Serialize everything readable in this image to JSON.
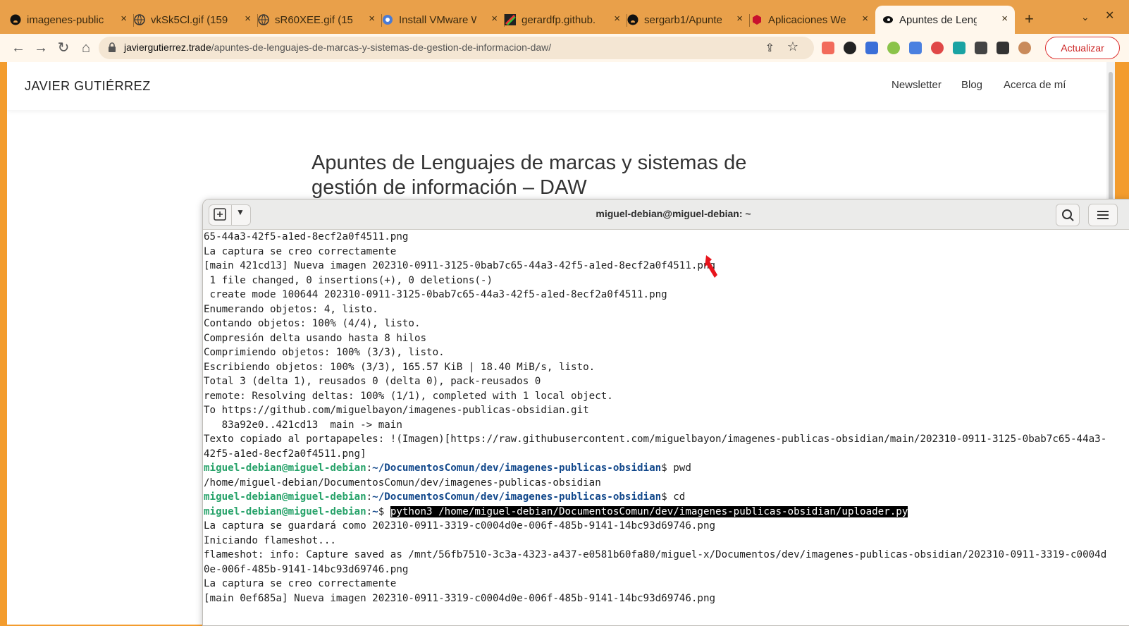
{
  "tabs": [
    {
      "title": "imagenes-public",
      "icon": "github-icon"
    },
    {
      "title": "vkSk5Cl.gif (1598",
      "icon": "globe-icon"
    },
    {
      "title": "sR60XEE.gif (159",
      "icon": "globe-icon"
    },
    {
      "title": "Install VMware W",
      "icon": "chrome-icon"
    },
    {
      "title": "gerardfp.github.",
      "icon": "gerardfp-icon"
    },
    {
      "title": "sergarb1/Apunte",
      "icon": "github-icon"
    },
    {
      "title": "Aplicaciones We",
      "icon": "hexagon-icon"
    },
    {
      "title": "Apuntes de Leng",
      "icon": "site-icon",
      "active": true
    }
  ],
  "browser": {
    "url_host": "javiergutierrez.trade",
    "url_path": "/apuntes-de-lenguajes-de-marcas-y-sistemas-de-gestion-de-informacion-daw/",
    "update_label": "Actualizar",
    "new_tab": "+"
  },
  "site": {
    "title": "JAVIER GUTIÉRREZ",
    "nav": [
      "Newsletter",
      "Blog",
      "Acerca de mí"
    ],
    "article_title": "Apuntes de Lenguajes de marcas y sistemas de gestión de información – DAW"
  },
  "terminal": {
    "title": "miguel-debian@miguel-debian: ~",
    "prompt_user": "miguel-debian@miguel-debian",
    "lines_top": [
      "65-44a3-42f5-a1ed-8ecf2a0f4511.png",
      "La captura se creo correctamente",
      "[main 421cd13] Nueva imagen 202310-0911-3125-0bab7c65-44a3-42f5-a1ed-8ecf2a0f4511.png",
      " 1 file changed, 0 insertions(+), 0 deletions(-)",
      " create mode 100644 202310-0911-3125-0bab7c65-44a3-42f5-a1ed-8ecf2a0f4511.png",
      "Enumerando objetos: 4, listo.",
      "Contando objetos: 100% (4/4), listo.",
      "Compresión delta usando hasta 8 hilos",
      "Comprimiendo objetos: 100% (3/3), listo.",
      "Escribiendo objetos: 100% (3/3), 165.57 KiB | 18.40 MiB/s, listo.",
      "Total 3 (delta 1), reusados 0 (delta 0), pack-reusados 0",
      "remote: Resolving deltas: 100% (1/1), completed with 1 local object.",
      "To https://github.com/miguelbayon/imagenes-publicas-obsidian.git",
      "   83a92e0..421cd13  main -> main",
      "Texto copiado al portapapeles: !(Imagen)[https://raw.githubusercontent.com/miguelbayon/imagenes-publicas-obsidian/main/202310-0911-3125-0bab7c65-44a3-",
      "42f5-a1ed-8ecf2a0f4511.png]"
    ],
    "prompt1_path": "~/DocumentosComun/dev/imagenes-publicas-obsidian",
    "prompt1_cmd": " pwd",
    "pwd_output": "/home/miguel-debian/DocumentosComun/dev/imagenes-publicas-obsidian",
    "prompt2_path": "~/DocumentosComun/dev/imagenes-publicas-obsidian",
    "prompt2_cmd": " cd",
    "prompt3_path": "~",
    "prompt3_cmd": "python3 /home/miguel-debian/DocumentosComun/dev/imagenes-publicas-obsidian/uploader.py",
    "lines_bottom": [
      "La captura se guardará como 202310-0911-3319-c0004d0e-006f-485b-9141-14bc93d69746.png",
      "Iniciando flameshot...",
      "flameshot: info: Capture saved as /mnt/56fb7510-3c3a-4323-a437-e0581b60fa80/miguel-x/Documentos/dev/imagenes-publicas-obsidian/202310-0911-3319-c0004d",
      "0e-006f-485b-9141-14bc93d69746.png",
      "La captura se creo correctamente",
      "[main 0ef685a] Nueva imagen 202310-0911-3319-c0004d0e-006f-485b-9141-14bc93d69746.png"
    ]
  },
  "colors": {
    "accent_orange": "#f39c2e",
    "prompt_green": "#26a269",
    "prompt_blue": "#12488b"
  }
}
